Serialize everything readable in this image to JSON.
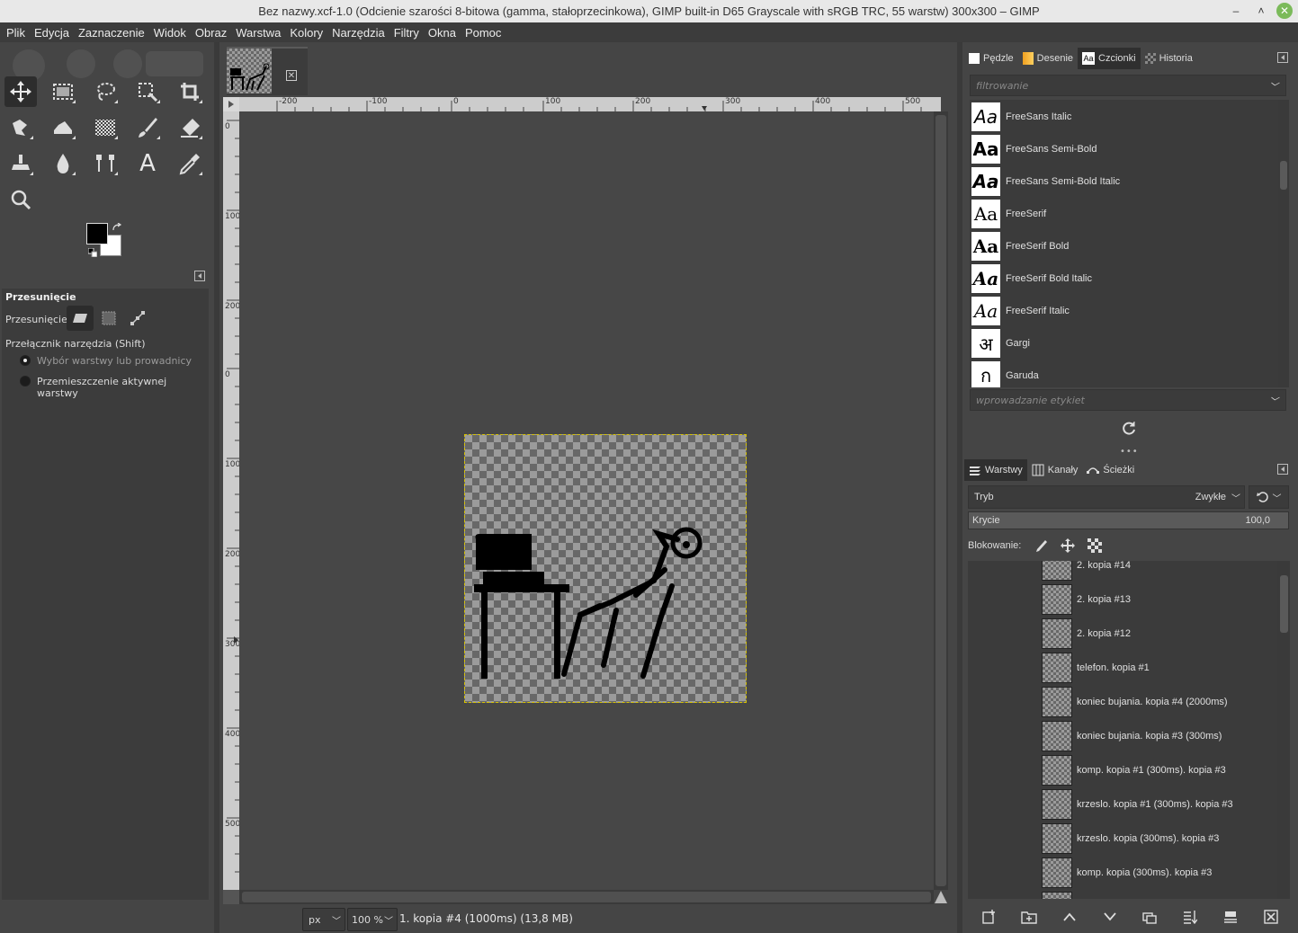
{
  "window": {
    "title": "Bez nazwy.xcf-1.0 (Odcienie szarości 8-bitowa (gamma, stałoprzecinkowa), GIMP built-in D65 Grayscale with sRGB TRC, 55 warstw) 300x300 – GIMP",
    "minimize": "–",
    "maximize": "˄"
  },
  "menu": [
    "Plik",
    "Edycja",
    "Zaznaczenie",
    "Widok",
    "Obraz",
    "Warstwa",
    "Kolory",
    "Narzędzia",
    "Filtry",
    "Okna",
    "Pomoc"
  ],
  "toolbox": {
    "tools": [
      "move-icon",
      "rect-select-icon",
      "lasso-icon",
      "fuzzy-select-icon",
      "crop-icon",
      "warp-icon",
      "smudge-icon",
      "gradient-icon",
      "paintbrush-icon",
      "eraser-icon",
      "clone-icon",
      "ink-drop-icon",
      "paths-icon",
      "text-icon",
      "color-picker-icon",
      "zoom-icon"
    ],
    "text_tool_glyph": "A",
    "fg_color": "#000000",
    "bg_color": "#ffffff"
  },
  "tool_options": {
    "title": "Przesunięcie",
    "mode_label": "Przesunięcie:",
    "switch_label": "Przełącznik narzędzia  (Shift)",
    "radio1": "Wybór warstwy lub prowadnicy",
    "radio2": "Przemieszczenie aktywnej warstwy"
  },
  "rulers": {
    "h_labels": [
      "-200",
      "-100",
      "0",
      "100",
      "200",
      "300",
      "400",
      "500"
    ],
    "v_labels": [
      "0",
      "100",
      "200",
      "0",
      "100",
      "200",
      "300",
      "400",
      "500"
    ]
  },
  "status": {
    "unit": "px",
    "zoom": "100 %",
    "text": "1. kopia #4 (1000ms) (13,8 MB)"
  },
  "fonts_dock": {
    "tabs": [
      "Pędzle",
      "Desenie",
      "Czcionki",
      "Historia"
    ],
    "filter_placeholder": "filtrowanie",
    "tag_placeholder": "wprowadzanie etykiet",
    "items": [
      {
        "preview": "Aa",
        "name": "FreeSans Italic"
      },
      {
        "preview": "Aa",
        "name": "FreeSans Semi-Bold"
      },
      {
        "preview": "Aa",
        "name": "FreeSans Semi-Bold Italic"
      },
      {
        "preview": "Aa",
        "name": "FreeSerif"
      },
      {
        "preview": "Aa",
        "name": "FreeSerif Bold"
      },
      {
        "preview": "Aa",
        "name": "FreeSerif Bold Italic"
      },
      {
        "preview": "Aa",
        "name": "FreeSerif Italic"
      },
      {
        "preview": "अ",
        "name": "Gargi"
      },
      {
        "preview": "ก",
        "name": "Garuda"
      }
    ]
  },
  "layers_dock": {
    "tabs": [
      "Warstwy",
      "Kanały",
      "Ścieżki"
    ],
    "mode_label": "Tryb",
    "mode_value": "Zwykłe",
    "opacity_label": "Krycie",
    "opacity_value": "100,0",
    "lock_label": "Blokowanie:",
    "layers": [
      "2. kopia #14",
      "2. kopia #13",
      "2. kopia #12",
      "telefon. kopia #1",
      "koniec bujania. kopia #4 (2000ms)",
      "koniec bujania. kopia #3 (300ms)",
      "komp. kopia #1 (300ms). kopia #3",
      "krzeslo. kopia #1 (300ms). kopia #3",
      "krzeslo. kopia (300ms). kopia #3",
      "komp. kopia (300ms). kopia #3"
    ]
  }
}
